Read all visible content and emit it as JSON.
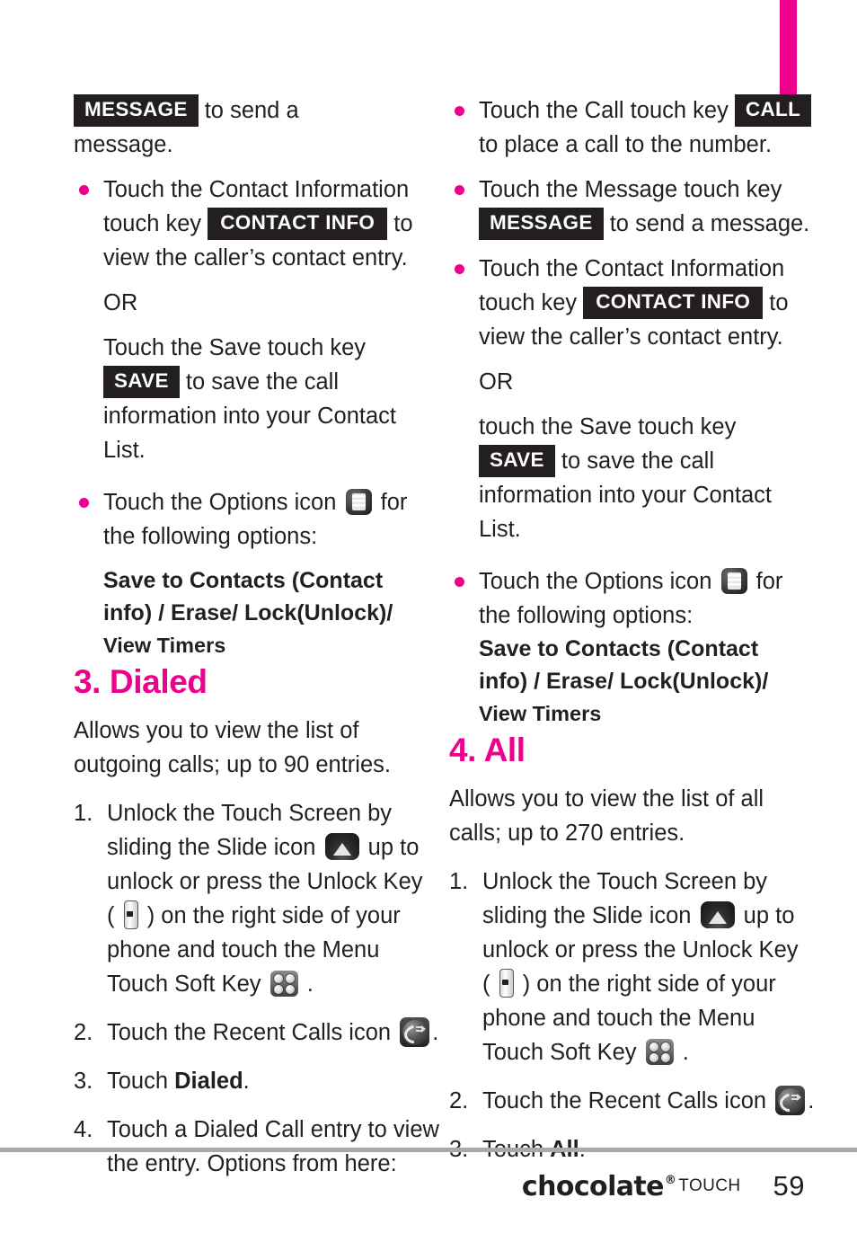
{
  "page": {
    "number": "59",
    "brand": "chocolate",
    "brand_reg": "®",
    "brand_sub": "TOUCH",
    "accent_color": "#ec008c",
    "tag_color": "#231f20",
    "rule_color": "#a7a9ac"
  },
  "left_column": {
    "frag_message": {
      "keytag": "MESSAGE",
      "text_after": "to send a",
      "line2": "message."
    },
    "bullet_contact_info": {
      "line1": "Touch the Contact Information",
      "line2_pre": "touch key",
      "keytag": "CONTACT INFO",
      "line2_post": "to",
      "line3": "view the caller’s contact entry."
    },
    "or_label": "OR",
    "save_block": {
      "line1": "Touch the Save touch key",
      "keytag": "SAVE",
      "line2_post": "to save the call",
      "line3": "information into your Contact",
      "line4": "List."
    },
    "bullet_options": {
      "pre": "Touch the Options icon",
      "icon": "options-icon",
      "post": "for",
      "line2": "the following options:"
    },
    "options_list": {
      "line1": "Save to Contacts (Contact",
      "line2": "info) / Erase/ Lock(Unlock)/",
      "line3": "View Timers"
    },
    "heading": "3. Dialed",
    "intro": {
      "line1": "Allows you to view the list of",
      "line2": "outgoing calls; up to 90 entries."
    },
    "steps": [
      {
        "num": "1.",
        "line1": "Unlock the Touch Screen by",
        "line2_pre": "sliding the Slide icon",
        "line2_icon": "slide-icon",
        "line2_post": "up to",
        "line3": "unlock or press the Unlock Key",
        "line4_pre": "(",
        "line4_icon": "unlock-key-icon",
        "line4_post": ") on the right side of your",
        "line5": "phone and touch the Menu",
        "line6_pre": "Touch Soft Key",
        "line6_icon": "menu-soft-key-icon",
        "line6_post": "."
      },
      {
        "num": "2.",
        "line1_pre": "Touch the Recent Calls icon",
        "line1_icon": "recent-calls-icon",
        "line1_post": "."
      },
      {
        "num": "3.",
        "line1_pre": "Touch ",
        "bold": "Dialed",
        "line1_post": "."
      },
      {
        "num": "4.",
        "line1": "Touch a Dialed Call entry to view",
        "line2": "the entry. Options from here:"
      }
    ]
  },
  "right_column": {
    "bullet_call": {
      "pre": "Touch the Call touch key",
      "keytag": "CALL",
      "line2": "to place a call to the number."
    },
    "bullet_message": {
      "line1": "Touch the Message touch key",
      "keytag": "MESSAGE",
      "line2_post": "to send a message."
    },
    "bullet_contact_info": {
      "line1": "Touch the Contact Information",
      "line2_pre": "touch key",
      "keytag": "CONTACT INFO",
      "line2_post": "to",
      "line3": "view the caller’s contact entry."
    },
    "or_label": "OR",
    "save_block": {
      "line1": "touch the Save touch key",
      "keytag": "SAVE",
      "line2_post": "to save the call",
      "line3": "information into your Contact",
      "line4": "List."
    },
    "bullet_options": {
      "pre": "Touch the Options icon",
      "icon": "options-icon",
      "post": "for",
      "line2": "the following options:"
    },
    "options_list": {
      "line1": "Save to Contacts (Contact",
      "line2": "info) / Erase/ Lock(Unlock)/",
      "line3": "View Timers"
    },
    "heading": "4. All",
    "intro": {
      "line1": "Allows you to view the list of all",
      "line2": "calls; up to 270 entries."
    },
    "steps": [
      {
        "num": "1.",
        "line1": "Unlock the Touch Screen by",
        "line2_pre": "sliding the Slide icon",
        "line2_icon": "slide-icon",
        "line2_post": "up to",
        "line3": "unlock or press the Unlock Key",
        "line4_pre": "(",
        "line4_icon": "unlock-key-icon",
        "line4_post": ") on the right side of your",
        "line5": "phone and touch the Menu",
        "line6_pre": "Touch Soft Key",
        "line6_icon": "menu-soft-key-icon",
        "line6_post": "."
      },
      {
        "num": "2.",
        "line1_pre": "Touch the Recent Calls icon",
        "line1_icon": "recent-calls-icon",
        "line1_post": "."
      },
      {
        "num": "3.",
        "line1_pre": "Touch ",
        "bold": "All",
        "line1_post": "."
      }
    ]
  }
}
